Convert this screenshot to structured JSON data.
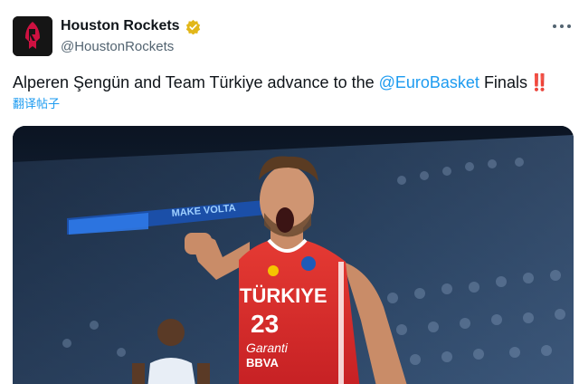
{
  "account": {
    "display_name": "Houston Rockets",
    "handle": "@HoustonRockets",
    "avatar_icon": "rockets-logo-icon",
    "verified_icon": "verified-badge-icon",
    "more_icon": "more-options-icon"
  },
  "post": {
    "text_prefix": "Alperen Şengün and Team Türkiye advance to the ",
    "mention": "@EuroBasket",
    "text_suffix": " Finals",
    "emoji": "‼️",
    "translate_label": "翻译帖子"
  },
  "media": {
    "jersey_text": "TÜRKIYE",
    "jersey_number": "23",
    "sponsor_line1": "Garanti",
    "sponsor_line2": "BBVA",
    "scoreboard_text": "MAKE VOLTA"
  },
  "colors": {
    "link": "#1d9bf0",
    "jersey_red": "#e0282c",
    "verified_gold": "#e2b719"
  }
}
